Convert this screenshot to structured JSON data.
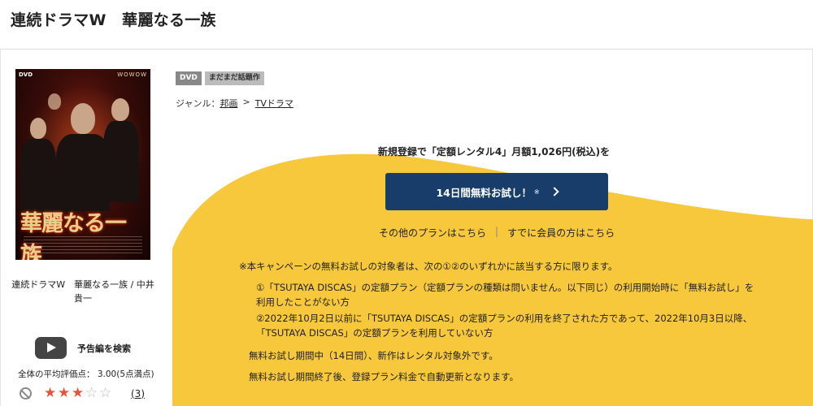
{
  "page": {
    "title": "連続ドラマW　華麗なる一族"
  },
  "product": {
    "poster": {
      "format_tag": "DVD",
      "brand": "WOWOW",
      "title_text": "華麗なる一族"
    },
    "title": "連続ドラマW　華麗なる一族 / 中井貴一",
    "trailer_label": "予告編を検索",
    "average_rating_text": "全体の平均評価点：  3.00(5点満点)",
    "rating": {
      "value": 3,
      "max": 5,
      "count_label": "(3)"
    }
  },
  "badges": [
    "DVD",
    "まだまだ話題作"
  ],
  "genre": {
    "label": "ジャンル：",
    "items": [
      "邦画",
      "TVドラマ"
    ],
    "separator": ">"
  },
  "promo": {
    "headline": "新規登録で「定額レンタル4」月額1,026円(税込)を",
    "cta_label": "14日間無料お試し！",
    "cta_mark": "※",
    "link_other_plans": "その他のプランはこちら",
    "link_divider": "|",
    "link_members": "すでに会員の方はこちら"
  },
  "notes": [
    "※本キャンペーンの無料お試しの対象者は、次の①②のいずれかに該当する方に限ります。",
    "①「TSUTAYA DISCAS」の定額プラン（定額プランの種類は問いません。以下同じ）の利用開始時に「無料お試し」を利用したことがない方",
    "②2022年10月2日以前に「TSUTAYA DISCAS」の定額プランの利用を終了された方であって、2022年10月3日以降、「TSUTAYA DISCAS」の定額プランを利用していない方",
    "無料お試し期間中（14日間）、新作はレンタル対象外です。",
    "無料お試し期間終了後、登録プラン料金で自動更新となります。"
  ],
  "colors": {
    "accent_yellow": "#f7c83c",
    "cta_navy": "#183d6a",
    "star": "#e8533a"
  }
}
